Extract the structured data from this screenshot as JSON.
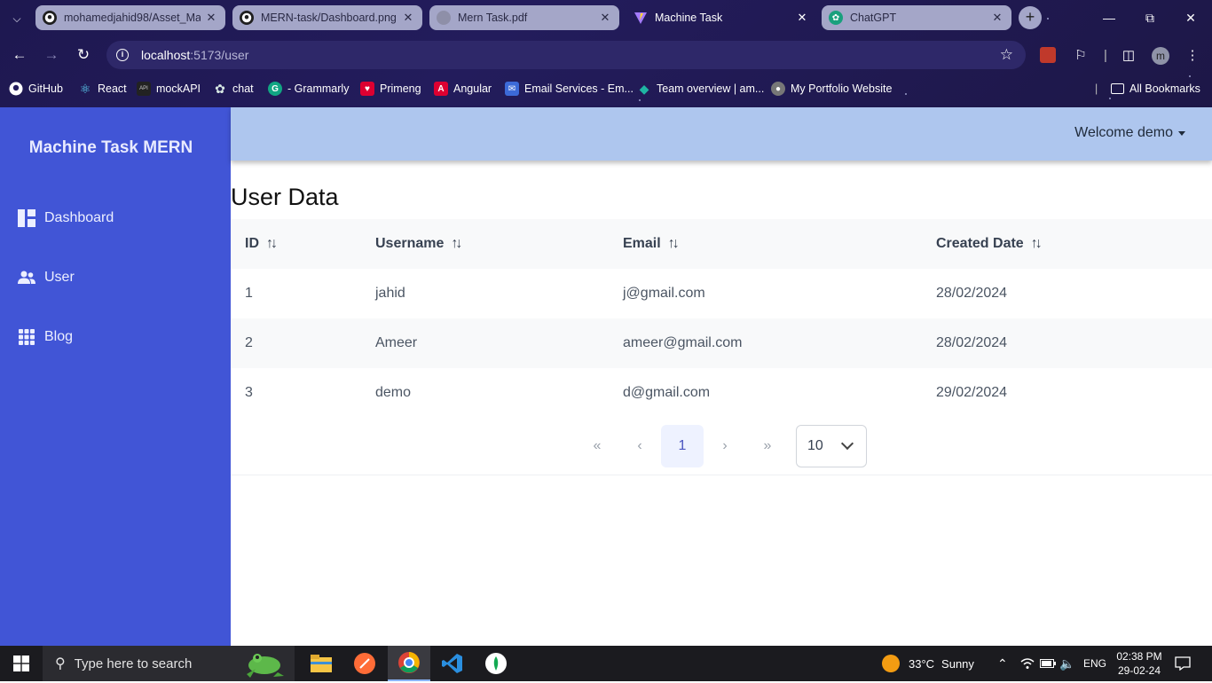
{
  "browser": {
    "tabs": [
      {
        "title": "mohamedjahid98/Asset_Ma",
        "icon": "github-icon",
        "active": false
      },
      {
        "title": "MERN-task/Dashboard.png",
        "icon": "github-icon",
        "active": false
      },
      {
        "title": "Mern Task.pdf",
        "icon": "pdf-icon",
        "active": false
      },
      {
        "title": "Machine Task",
        "icon": "vite-icon",
        "active": true
      },
      {
        "title": "ChatGPT",
        "icon": "chatgpt-icon",
        "active": false
      }
    ],
    "url_host": "localhost",
    "url_rest": ":5173/user",
    "bookmarks": [
      {
        "label": "GitHub",
        "icon": "github-icon"
      },
      {
        "label": "React",
        "icon": "react-icon"
      },
      {
        "label": "mockAPI",
        "icon": "mockapi-icon"
      },
      {
        "label": "chat",
        "icon": "chatgpt-icon"
      },
      {
        "label": "- Grammarly",
        "icon": "grammarly-icon"
      },
      {
        "label": "Primeng",
        "icon": "primeng-icon"
      },
      {
        "label": "Angular",
        "icon": "angular-icon"
      },
      {
        "label": "Email Services - Em...",
        "icon": "email-icon"
      },
      {
        "label": "Team overview | am...",
        "icon": "team-icon"
      },
      {
        "label": "My Portfolio Website",
        "icon": "globe-icon"
      }
    ],
    "all_bookmarks": "All Bookmarks",
    "profile_initial": "m"
  },
  "sidebar": {
    "brand": "Machine Task MERN",
    "items": [
      {
        "label": "Dashboard",
        "icon": "dashboard-icon"
      },
      {
        "label": "User",
        "icon": "users-icon"
      },
      {
        "label": "Blog",
        "icon": "grid-icon"
      }
    ]
  },
  "header": {
    "welcome": "Welcome demo"
  },
  "main": {
    "title": "User Data",
    "columns": [
      "ID",
      "Username",
      "Email",
      "Created Date"
    ],
    "rows": [
      {
        "id": "1",
        "username": "jahid",
        "email": "j@gmail.com",
        "created": "28/02/2024"
      },
      {
        "id": "2",
        "username": "Ameer",
        "email": "ameer@gmail.com",
        "created": "28/02/2024"
      },
      {
        "id": "3",
        "username": "demo",
        "email": "d@gmail.com",
        "created": "29/02/2024"
      }
    ],
    "paginator": {
      "first": "«",
      "prev": "‹",
      "current_page": "1",
      "next": "›",
      "last": "»",
      "rows_per_page": "10"
    }
  },
  "taskbar": {
    "search_placeholder": "Type here to search",
    "weather_temp": "33°C",
    "weather_desc": "Sunny",
    "language": "ENG",
    "time": "02:38 PM",
    "date": "29-02-24"
  },
  "colors": {
    "sidebar": "#4155d6",
    "header": "#aec6ee",
    "browser_chrome": "#1e1850"
  }
}
